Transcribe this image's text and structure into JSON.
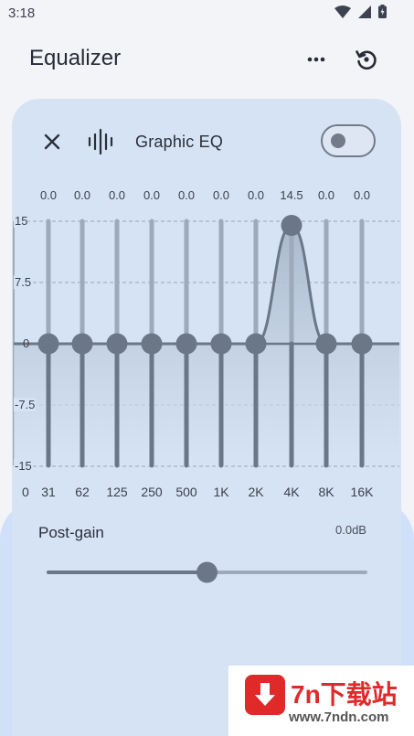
{
  "status_bar": {
    "time": "3:18"
  },
  "app_bar": {
    "title": "Equalizer"
  },
  "card": {
    "title": "Graphic EQ",
    "enabled": false
  },
  "eq": {
    "db_scale": [
      "15",
      "7.5",
      "0",
      "-7.5",
      "-15"
    ],
    "axis_zero": "0",
    "bands": [
      {
        "freq": "31",
        "value": "0.0"
      },
      {
        "freq": "62",
        "value": "0.0"
      },
      {
        "freq": "125",
        "value": "0.0"
      },
      {
        "freq": "250",
        "value": "0.0"
      },
      {
        "freq": "500",
        "value": "0.0"
      },
      {
        "freq": "1K",
        "value": "0.0"
      },
      {
        "freq": "2K",
        "value": "0.0"
      },
      {
        "freq": "4K",
        "value": "14.5"
      },
      {
        "freq": "8K",
        "value": "0.0"
      },
      {
        "freq": "16K",
        "value": "0.0"
      }
    ],
    "range": [
      -15,
      15
    ],
    "colors": {
      "track": "#9aa6b6",
      "thumb": "#6b7686",
      "fill": "#a9b8cc"
    }
  },
  "post_gain": {
    "label": "Post-gain",
    "value": "0.0dB",
    "slider_fraction": 0.5
  },
  "watermark": {
    "title": "7n下载站",
    "url": "www.7ndn.com"
  }
}
